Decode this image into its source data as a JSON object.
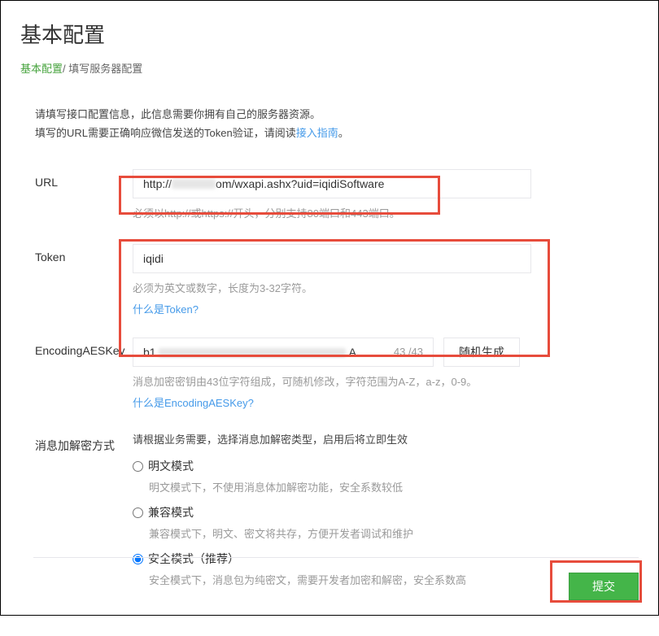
{
  "page": {
    "title": "基本配置",
    "breadcrumb": {
      "root": "基本配置",
      "separator": "/ ",
      "current": "填写服务器配置"
    }
  },
  "intro": {
    "line1": "请填写接口配置信息，此信息需要你拥有自己的服务器资源。",
    "line2_pre": "填写的URL需要正确响应微信发送的Token验证，请阅读",
    "line2_link": "接入指南",
    "line2_post": "。"
  },
  "fields": {
    "url": {
      "label": "URL",
      "value_prefix": "http://",
      "value_mid_hidden": true,
      "value_suffix": "om/wxapi.ashx?uid=iqidiSoftware",
      "helper": "必须以http://或https://开头，分别支持80端口和443端口。"
    },
    "token": {
      "label": "Token",
      "value": "iqidi",
      "helper": "必须为英文或数字，长度为3-32字符。",
      "helper_link": "什么是Token?"
    },
    "aeskey": {
      "label": "EncodingAESKey",
      "value_prefix": "b1",
      "value_hidden": true,
      "value_suffix": "A",
      "counter": "43 /43",
      "btn_generate": "随机生成",
      "helper": "消息加密密钥由43位字符组成，可随机修改，字符范围为A-Z，a-z，0-9。",
      "helper_link": "什么是EncodingAESKey?"
    },
    "encrypt": {
      "label": "消息加解密方式",
      "title": "请根据业务需要，选择消息加解密类型，启用后将立即生效",
      "options": [
        {
          "label": "明文模式",
          "desc": "明文模式下，不使用消息体加解密功能，安全系数较低",
          "checked": false
        },
        {
          "label": "兼容模式",
          "desc": "兼容模式下，明文、密文将共存，方便开发者调试和维护",
          "checked": false
        },
        {
          "label": "安全模式（推荐）",
          "desc": "安全模式下，消息包为纯密文，需要开发者加密和解密，安全系数高",
          "checked": true
        }
      ]
    }
  },
  "footer": {
    "submit": "提交"
  }
}
